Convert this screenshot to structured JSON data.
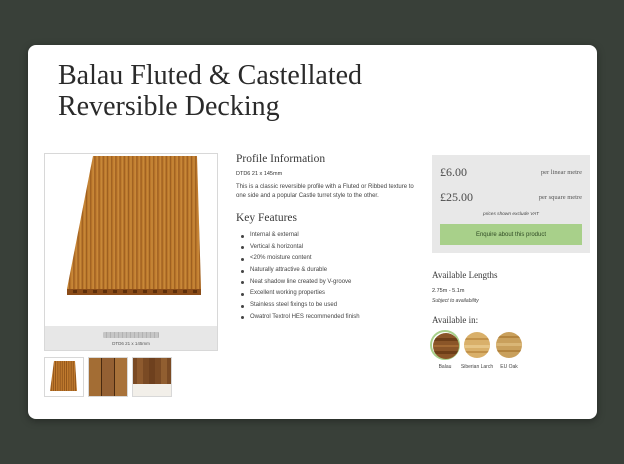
{
  "product": {
    "title": "Balau Fluted & Castellated Reversible Decking"
  },
  "gallery": {
    "main_caption": "DTD6 21 x 145mm",
    "thumbnails": [
      "thumb-1",
      "thumb-2",
      "thumb-3"
    ]
  },
  "profile": {
    "heading": "Profile Information",
    "code": "DTD6 21 x 145mm",
    "description": "This is a classic reversible profile with a Fluted or Ribbed texture to one side and a popular Castle turret style to the other."
  },
  "features": {
    "heading": "Key Features",
    "items": [
      "Internal & external",
      "Vertical & horizontal",
      "<20% moisture content",
      "Naturally attractive & durable",
      "Neat shadow line created by V-groove",
      "Excellent working properties",
      "Stainless steel fixings to be used",
      "Owatrol Textrol HES recommended finish"
    ]
  },
  "pricing": {
    "linear_price": "£6.00",
    "linear_unit": "per linear metre",
    "square_price": "£25.00",
    "square_unit": "per square metre",
    "vat_note": "prices shown exclude VAT",
    "enquire_label": "Enquire about this product"
  },
  "availability": {
    "lengths_heading": "Available Lengths",
    "lengths_value": "2.75m - 5.1m",
    "lengths_note": "Subject to availability",
    "available_in_heading": "Available in:",
    "species": [
      {
        "label": "Balau",
        "selected": true
      },
      {
        "label": "Siberian Larch",
        "selected": false
      },
      {
        "label": "EU Oak",
        "selected": false
      }
    ]
  },
  "colors": {
    "background": "#394039",
    "accent_green": "#a8d08a",
    "price_box": "#e8e8e8"
  }
}
